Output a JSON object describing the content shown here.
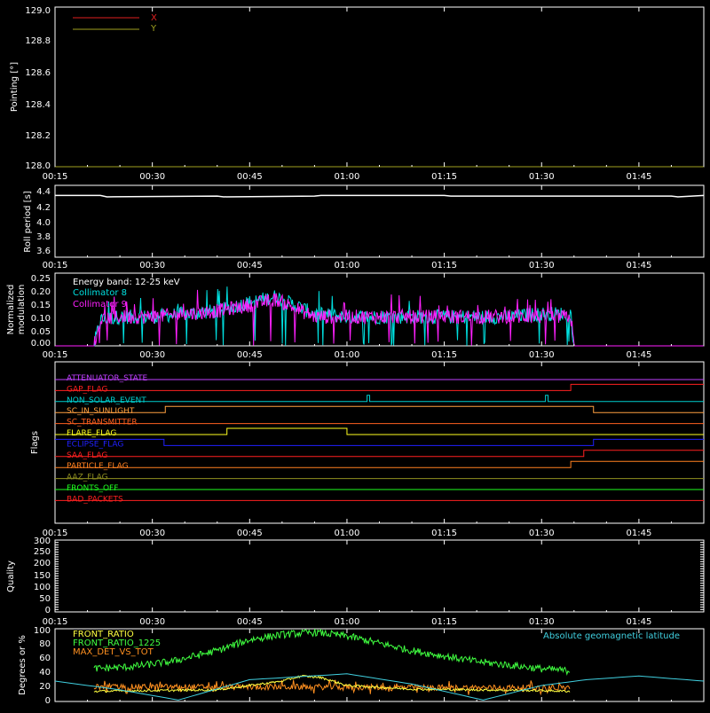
{
  "panels": {
    "pointing": {
      "ylabel": "Pointing [°]",
      "yticks": [
        "128.0",
        "128.2",
        "128.4",
        "128.6",
        "128.8",
        "129.0"
      ],
      "legend": [
        {
          "label": "X",
          "color": "#e02020"
        },
        {
          "label": "Y",
          "color": "#a0a020"
        }
      ]
    },
    "roll": {
      "ylabel": "Roll period [s]",
      "yticks": [
        "3.6",
        "3.8",
        "4.0",
        "4.2",
        "4.4"
      ]
    },
    "modulation": {
      "ylabel_line1": "Normalized",
      "ylabel_line2": "modulation",
      "yticks": [
        "0.00",
        "0.05",
        "0.10",
        "0.15",
        "0.20",
        "0.25"
      ],
      "annotation": "Energy band: 12-25 keV",
      "legend": [
        {
          "label": "Collimator 8",
          "color": "#00e0e0"
        },
        {
          "label": "Collimator 9",
          "color": "#ff20ff"
        }
      ]
    },
    "flags": {
      "ylabel": "Flags"
    },
    "quality": {
      "ylabel": "Quality",
      "yticks": [
        "0",
        "50",
        "100",
        "150",
        "200",
        "250",
        "300"
      ]
    },
    "ratios": {
      "ylabel": "Degrees or %",
      "yticks": [
        "0",
        "20",
        "40",
        "60",
        "80",
        "100"
      ],
      "legend": [
        {
          "label": "FRONT_RATIO",
          "color": "#ffff40"
        },
        {
          "label": "FRONT_RATIO_1225",
          "color": "#40ff40"
        },
        {
          "label": "MAX_DET_VS_TOT",
          "color": "#ff9020"
        }
      ],
      "right_label": "Absolute geomagnetic latitude",
      "right_label_color": "#40d0e0"
    }
  },
  "time_ticks": [
    "00:15",
    "00:30",
    "00:45",
    "01:00",
    "01:15",
    "01:30",
    "01:45"
  ],
  "chart_data": [
    {
      "type": "line",
      "ylabel": "Pointing [°]",
      "x_unit": "minutes since 00:15",
      "xlim": [
        0,
        100
      ],
      "ylim": [
        128.0,
        129.0
      ],
      "series": [
        {
          "name": "X",
          "x": [
            0,
            100
          ],
          "y": [
            128.0,
            128.0
          ]
        },
        {
          "name": "Y",
          "x": [
            0,
            100
          ],
          "y": [
            128.0,
            128.0
          ]
        }
      ]
    },
    {
      "type": "line",
      "ylabel": "Roll period [s]",
      "xlim": [
        0,
        100
      ],
      "ylim": [
        3.5,
        4.5
      ],
      "series": [
        {
          "x": [
            0,
            7,
            8,
            25,
            26,
            40,
            41,
            60,
            61,
            95,
            96,
            100
          ],
          "y": [
            4.36,
            4.36,
            4.34,
            4.35,
            4.34,
            4.35,
            4.36,
            4.36,
            4.35,
            4.35,
            4.34,
            4.36
          ]
        }
      ]
    },
    {
      "type": "line",
      "ylabel": "Normalized modulation",
      "xlim": [
        0,
        100
      ],
      "ylim": [
        0,
        0.25
      ],
      "series": [
        {
          "name": "Collimator 8",
          "x": [
            0,
            6,
            7,
            10,
            15,
            20,
            25,
            30,
            34,
            37,
            40,
            45,
            50,
            55,
            60,
            65,
            70,
            75,
            79.5,
            80,
            100
          ],
          "y": [
            0,
            0,
            0.09,
            0.1,
            0.1,
            0.11,
            0.12,
            0.15,
            0.17,
            0.14,
            0.11,
            0.1,
            0.1,
            0.1,
            0.1,
            0.1,
            0.1,
            0.11,
            0.11,
            0,
            0
          ]
        },
        {
          "name": "Collimator 9",
          "x": [
            0,
            6,
            7,
            10,
            15,
            20,
            25,
            30,
            34,
            37,
            40,
            45,
            50,
            55,
            60,
            65,
            70,
            75,
            79.5,
            80,
            100
          ],
          "y": [
            0,
            0,
            0.09,
            0.1,
            0.1,
            0.11,
            0.12,
            0.14,
            0.16,
            0.13,
            0.1,
            0.1,
            0.1,
            0.1,
            0.1,
            0.1,
            0.1,
            0.1,
            0.1,
            0,
            0
          ]
        }
      ]
    },
    {
      "type": "line",
      "ylabel": "Flags",
      "xlim": [
        0,
        100
      ],
      "series": [
        {
          "name": "ATTENUATOR_STATE",
          "color": "#c040ff",
          "steps": []
        },
        {
          "name": "GAP_FLAG",
          "color": "#ff2020",
          "steps": [
            [
              79.5,
              100
            ]
          ]
        },
        {
          "name": "NON_SOLAR_EVENT",
          "color": "#00d0d0",
          "steps": [
            [
              48.1,
              48.5
            ],
            [
              75.6,
              76.0
            ]
          ]
        },
        {
          "name": "SC_IN_SUNLIGHT",
          "color": "#ffa040",
          "steps": [
            [
              17.0,
              83.0
            ]
          ]
        },
        {
          "name": "SC_TRANSMITTER",
          "color": "#ff6020",
          "steps": []
        },
        {
          "name": "FLARE_FLAG",
          "color": "#ffff20",
          "steps": [
            [
              26.5,
              45.0
            ]
          ]
        },
        {
          "name": "ECLIPSE_FLAG",
          "color": "#2020ff",
          "steps": [
            [
              0,
              16.8
            ],
            [
              83.0,
              100
            ]
          ]
        },
        {
          "name": "SAA_FLAG",
          "color": "#ff2020",
          "steps": [
            [
              81.5,
              100
            ]
          ]
        },
        {
          "name": "PARTICLE_FLAG",
          "color": "#ff8020",
          "steps": [
            [
              79.5,
              100
            ]
          ]
        },
        {
          "name": "AAZ_FLAG",
          "color": "#909020",
          "steps": []
        },
        {
          "name": "FRONTS_OFF",
          "color": "#20ff20",
          "steps": []
        },
        {
          "name": "BAD_PACKETS",
          "color": "#ff2020",
          "steps": []
        }
      ]
    },
    {
      "type": "line",
      "ylabel": "Quality",
      "xlim": [
        0,
        100
      ],
      "ylim": [
        0,
        300
      ],
      "series": []
    },
    {
      "type": "line",
      "ylabel": "Degrees or %",
      "xlim": [
        0,
        100
      ],
      "ylim": [
        0,
        100
      ],
      "series": [
        {
          "name": "FRONT_RATIO",
          "x": [
            6,
            15,
            25,
            30,
            35,
            38,
            41,
            45,
            55,
            65,
            75,
            79.5
          ],
          "y": [
            14,
            15,
            16,
            22,
            28,
            35,
            33,
            22,
            17,
            16,
            15,
            14
          ]
        },
        {
          "name": "FRONT_RATIO_1225",
          "x": [
            6,
            12,
            18,
            25,
            30,
            35,
            40,
            45,
            50,
            55,
            65,
            75,
            79.5
          ],
          "y": [
            45,
            48,
            55,
            70,
            85,
            92,
            95,
            90,
            80,
            70,
            55,
            45,
            42
          ]
        },
        {
          "name": "MAX_DET_VS_TOT",
          "x": [
            6,
            20,
            40,
            60,
            79.5
          ],
          "y": [
            20,
            20,
            20,
            19,
            19
          ]
        },
        {
          "name": "Absolute geomagnetic latitude",
          "x": [
            0,
            10,
            19,
            30,
            45,
            55,
            66,
            75,
            82,
            90,
            100
          ],
          "y": [
            28,
            16,
            2,
            30,
            38,
            24,
            2,
            22,
            30,
            35,
            28
          ]
        }
      ]
    }
  ]
}
